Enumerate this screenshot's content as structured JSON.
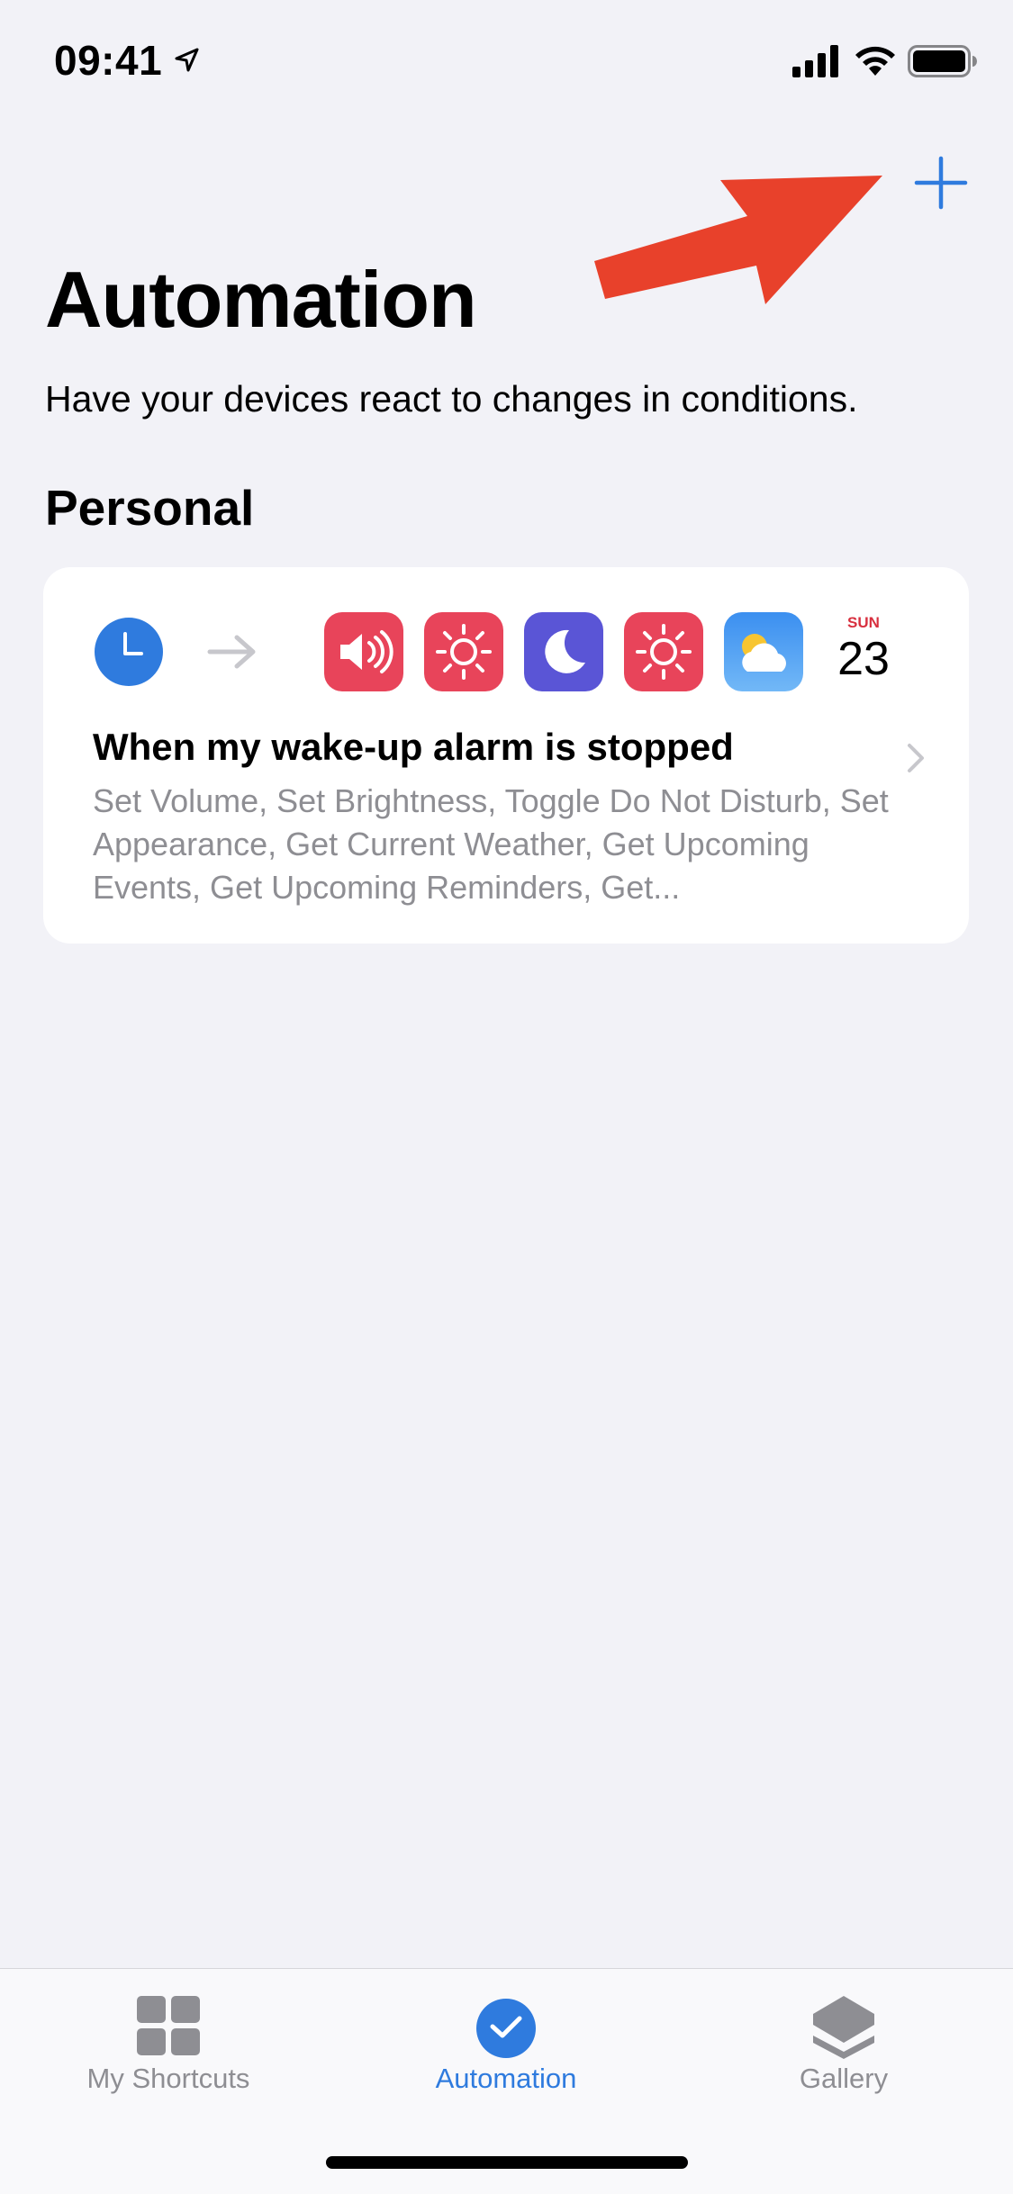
{
  "status_bar": {
    "time": "09:41",
    "icons": [
      "location-arrow-icon",
      "signal-icon",
      "wifi-icon",
      "battery-icon"
    ]
  },
  "header": {
    "add_icon": "plus-icon",
    "add_color": "#2f7bde"
  },
  "page": {
    "title": "Automation",
    "subtitle": "Have your devices react to changes in conditions."
  },
  "section": {
    "title": "Personal"
  },
  "automation_card": {
    "trigger_icon": "alarm-clock-icon",
    "action_icons": [
      "volume-icon",
      "brightness-icon",
      "do-not-disturb-moon-icon",
      "brightness-icon",
      "weather-icon",
      "calendar-icon"
    ],
    "calendar": {
      "day": "SUN",
      "date": "23"
    },
    "title": "When my wake-up alarm is stopped",
    "description": "Set Volume, Set Brightness, Toggle Do Not Disturb, Set Appearance, Get Current Weather, Get Upcoming Events, Get Upcoming Reminders, Get..."
  },
  "tab_bar": {
    "tabs": [
      {
        "label": "My Shortcuts",
        "icon": "grid-icon",
        "active": false
      },
      {
        "label": "Automation",
        "icon": "checkmark-circle-icon",
        "active": true
      },
      {
        "label": "Gallery",
        "icon": "stack-layers-icon",
        "active": false
      }
    ]
  },
  "colors": {
    "background": "#f2f2f7",
    "accent": "#2f7bde",
    "red_tile": "#e8445a",
    "purple_tile": "#5a55d6",
    "annotation_arrow": "#e8412b"
  }
}
